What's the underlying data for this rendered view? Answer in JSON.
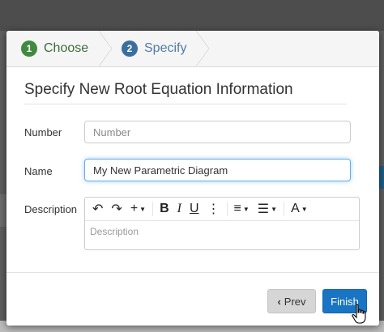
{
  "wizard": {
    "steps": [
      {
        "number": "1",
        "label": "Choose"
      },
      {
        "number": "2",
        "label": "Specify"
      }
    ]
  },
  "form": {
    "title": "Specify New Root Equation Information",
    "number_label": "Number",
    "number_placeholder": "Number",
    "number_value": "",
    "name_label": "Name",
    "name_value": "My New Parametric Diagram",
    "description_label": "Description",
    "description_placeholder": "Description"
  },
  "toolbar": {
    "undo": "↶",
    "redo": "↷",
    "insert": "+",
    "bold": "B",
    "italic": "I",
    "underline": "U",
    "more": "⋮",
    "align": "≡",
    "list": "☰",
    "font": "A"
  },
  "buttons": {
    "prev_label": "Prev",
    "finish_label": "Finish"
  },
  "colors": {
    "accent": "#1a74c4",
    "step_active": "#3a6f9e",
    "step_done": "#3f8a3f"
  }
}
